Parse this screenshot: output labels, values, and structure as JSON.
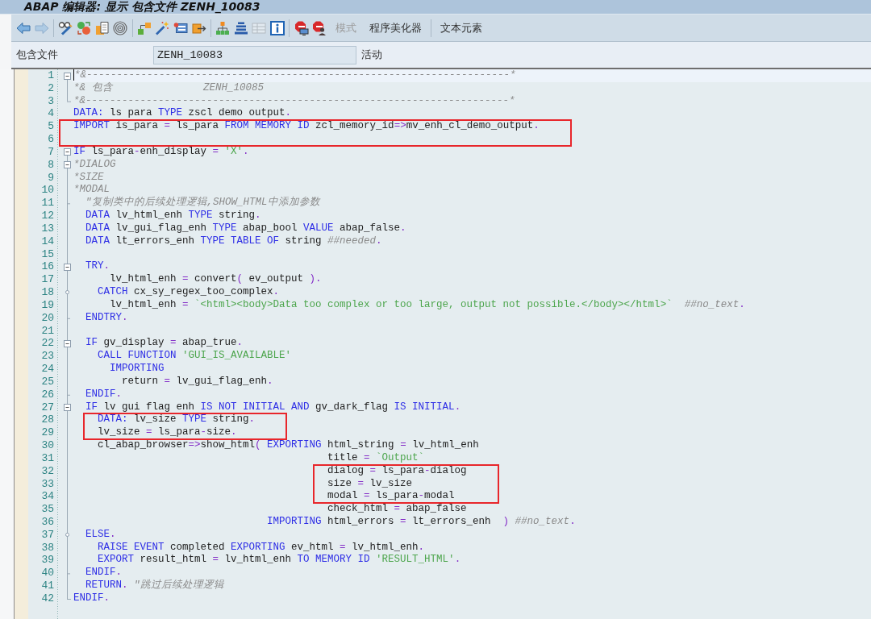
{
  "window": {
    "title": "ABAP 编辑器: 显示 包含文件 ZENH_10083"
  },
  "toolbar": [
    {
      "kind": "icon",
      "disabled": false
    },
    {
      "kind": "icon",
      "disabled": true
    },
    {
      "kind": "separator"
    },
    {
      "kind": "icon",
      "disabled": false
    },
    {
      "kind": "icon",
      "disabled": false
    },
    {
      "kind": "icon",
      "disabled": false
    },
    {
      "kind": "icon",
      "disabled": false
    },
    {
      "kind": "separator"
    },
    {
      "kind": "icon",
      "disabled": false
    },
    {
      "kind": "icon",
      "disabled": false
    },
    {
      "kind": "icon",
      "disabled": false
    },
    {
      "kind": "icon",
      "disabled": false
    },
    {
      "kind": "separator"
    },
    {
      "kind": "icon",
      "disabled": false
    },
    {
      "kind": "icon",
      "disabled": false
    },
    {
      "kind": "icon",
      "disabled": true
    },
    {
      "kind": "icon",
      "disabled": false
    },
    {
      "kind": "separator"
    },
    {
      "kind": "icon",
      "disabled": false
    },
    {
      "kind": "icon",
      "disabled": false
    },
    {
      "kind": "text",
      "label": "模式",
      "disabled": true
    },
    {
      "kind": "text",
      "label": "程序美化器",
      "disabled": false
    },
    {
      "kind": "separator"
    },
    {
      "kind": "text",
      "label": "文本元素",
      "disabled": false
    }
  ],
  "include": {
    "label": "包含文件",
    "value": "ZENH_10083",
    "status": "活动"
  },
  "editor": {
    "lines": [
      {
        "number": "1",
        "current": true,
        "boxed": false,
        "kind": "open",
        "tokens": [
          {
            "kind": "comment",
            "text": "*&----------------------------------------------------------------------*"
          }
        ]
      },
      {
        "number": "2",
        "current": false,
        "boxed": false,
        "kind": "line",
        "tokens": [
          {
            "kind": "comment",
            "text": "*& 包含               ZENH_10085"
          }
        ]
      },
      {
        "number": "3",
        "current": false,
        "boxed": false,
        "kind": "end",
        "tokens": [
          {
            "kind": "comment",
            "text": "*&----------------------------------------------------------------------*"
          }
        ]
      },
      {
        "number": "4",
        "current": false,
        "boxed": false,
        "kind": "plain",
        "tokens": [
          {
            "kind": "keyword",
            "text": "DATA:"
          },
          {
            "kind": "name",
            "text": " ls para "
          },
          {
            "kind": "keyword",
            "text": "TYPE"
          },
          {
            "kind": "name",
            "text": " zscl demo output"
          },
          {
            "kind": "operator",
            "text": "."
          }
        ]
      },
      {
        "number": "5",
        "current": false,
        "boxed": true,
        "kind": "plain",
        "tokens": [
          {
            "kind": "keyword",
            "text": "IMPORT"
          },
          {
            "kind": "name",
            "text": " is_para "
          },
          {
            "kind": "operator",
            "text": "="
          },
          {
            "kind": "name",
            "text": " ls_para "
          },
          {
            "kind": "keyword",
            "text": "FROM MEMORY ID"
          },
          {
            "kind": "name",
            "text": " zcl_memory_id"
          },
          {
            "kind": "operator",
            "text": "=>"
          },
          {
            "kind": "name",
            "text": "mv_enh_cl_demo_output"
          },
          {
            "kind": "operator",
            "text": "."
          }
        ]
      },
      {
        "number": "6",
        "current": false,
        "boxed": true,
        "kind": "plain"
      },
      {
        "number": "7",
        "current": false,
        "boxed": false,
        "kind": "open",
        "tokens": [
          {
            "kind": "keyword",
            "text": "IF"
          },
          {
            "kind": "name",
            "text": " ls_para"
          },
          {
            "kind": "operator",
            "text": "-"
          },
          {
            "kind": "name",
            "text": "enh_display "
          },
          {
            "kind": "operator",
            "text": "= "
          },
          {
            "kind": "string",
            "text": "'X'"
          },
          {
            "kind": "operator",
            "text": "."
          }
        ]
      },
      {
        "number": "8",
        "current": false,
        "boxed": false,
        "kind": "open",
        "tokens": [
          {
            "kind": "comment",
            "text": "*DIALOG"
          }
        ]
      },
      {
        "number": "9",
        "current": false,
        "boxed": false,
        "kind": "line",
        "tokens": [
          {
            "kind": "comment",
            "text": "*SIZE"
          }
        ]
      },
      {
        "number": "10",
        "current": false,
        "boxed": false,
        "kind": "line",
        "tokens": [
          {
            "kind": "comment",
            "text": "*MODAL"
          }
        ]
      },
      {
        "number": "11",
        "current": false,
        "boxed": false,
        "kind": "tick",
        "tokens": [
          {
            "kind": "comment",
            "text": "  \"复制类中的后续处理逻辑,SHOW_HTML中添加参数"
          }
        ]
      },
      {
        "number": "12",
        "current": false,
        "boxed": false,
        "kind": "line",
        "tokens": [
          {
            "kind": "keyword",
            "text": "  DATA"
          },
          {
            "kind": "name",
            "text": " lv_html_enh "
          },
          {
            "kind": "keyword",
            "text": "TYPE"
          },
          {
            "kind": "name",
            "text": " string"
          },
          {
            "kind": "operator",
            "text": "."
          }
        ]
      },
      {
        "number": "13",
        "current": false,
        "boxed": false,
        "kind": "line",
        "tokens": [
          {
            "kind": "keyword",
            "text": "  DATA"
          },
          {
            "kind": "name",
            "text": " lv_gui_flag_enh "
          },
          {
            "kind": "keyword",
            "text": "TYPE"
          },
          {
            "kind": "name",
            "text": " abap_bool "
          },
          {
            "kind": "keyword",
            "text": "VALUE"
          },
          {
            "kind": "name",
            "text": " abap_false"
          },
          {
            "kind": "operator",
            "text": "."
          }
        ]
      },
      {
        "number": "14",
        "current": false,
        "boxed": false,
        "kind": "line",
        "tokens": [
          {
            "kind": "keyword",
            "text": "  DATA"
          },
          {
            "kind": "name",
            "text": " lt_errors_enh "
          },
          {
            "kind": "keyword",
            "text": "TYPE TABLE OF"
          },
          {
            "kind": "name",
            "text": " string "
          },
          {
            "kind": "comment",
            "text": "##needed"
          },
          {
            "kind": "operator",
            "text": "."
          }
        ]
      },
      {
        "number": "15",
        "current": false,
        "boxed": false,
        "kind": "line"
      },
      {
        "number": "16",
        "current": false,
        "boxed": false,
        "kind": "open",
        "tokens": [
          {
            "kind": "keyword",
            "text": "  TRY"
          },
          {
            "kind": "operator",
            "text": "."
          }
        ]
      },
      {
        "number": "17",
        "current": false,
        "boxed": false,
        "kind": "line",
        "tokens": [
          {
            "kind": "name",
            "text": "      lv_html_enh "
          },
          {
            "kind": "operator",
            "text": "= "
          },
          {
            "kind": "name",
            "text": "convert"
          },
          {
            "kind": "operator",
            "text": "( "
          },
          {
            "kind": "name",
            "text": "ev_output "
          },
          {
            "kind": "operator",
            "text": ")."
          }
        ]
      },
      {
        "number": "18",
        "current": false,
        "boxed": false,
        "kind": "branch",
        "tokens": [
          {
            "kind": "keyword",
            "text": "    CATCH"
          },
          {
            "kind": "name",
            "text": " cx_sy_regex_too_complex"
          },
          {
            "kind": "operator",
            "text": "."
          }
        ]
      },
      {
        "number": "19",
        "current": false,
        "boxed": false,
        "kind": "line",
        "tokens": [
          {
            "kind": "name",
            "text": "      lv_html_enh "
          },
          {
            "kind": "operator",
            "text": "= "
          },
          {
            "kind": "string",
            "text": "`<html><body>Data too complex or too large, output not possible.</body></html>`"
          },
          {
            "kind": "comment",
            "text": "  ##no_text"
          },
          {
            "kind": "operator",
            "text": "."
          }
        ]
      },
      {
        "number": "20",
        "current": false,
        "boxed": false,
        "kind": "tick",
        "tokens": [
          {
            "kind": "keyword",
            "text": "  ENDTRY"
          },
          {
            "kind": "operator",
            "text": "."
          }
        ]
      },
      {
        "number": "21",
        "current": false,
        "boxed": false,
        "kind": "line"
      },
      {
        "number": "22",
        "current": false,
        "boxed": false,
        "kind": "open",
        "tokens": [
          {
            "kind": "keyword",
            "text": "  IF"
          },
          {
            "kind": "name",
            "text": " gv_display "
          },
          {
            "kind": "operator",
            "text": "= "
          },
          {
            "kind": "name",
            "text": "abap_true"
          },
          {
            "kind": "operator",
            "text": "."
          }
        ]
      },
      {
        "number": "23",
        "current": false,
        "boxed": false,
        "kind": "line",
        "tokens": [
          {
            "kind": "keyword",
            "text": "    CALL FUNCTION "
          },
          {
            "kind": "string",
            "text": "'GUI_IS_AVAILABLE'"
          }
        ]
      },
      {
        "number": "24",
        "current": false,
        "boxed": false,
        "kind": "line",
        "tokens": [
          {
            "kind": "keyword",
            "text": "      IMPORTING"
          }
        ]
      },
      {
        "number": "25",
        "current": false,
        "boxed": false,
        "kind": "line",
        "tokens": [
          {
            "kind": "name",
            "text": "        return "
          },
          {
            "kind": "operator",
            "text": "= "
          },
          {
            "kind": "name",
            "text": "lv_gui_flag_enh"
          },
          {
            "kind": "operator",
            "text": "."
          }
        ]
      },
      {
        "number": "26",
        "current": false,
        "boxed": false,
        "kind": "tick",
        "tokens": [
          {
            "kind": "keyword",
            "text": "  ENDIF"
          },
          {
            "kind": "operator",
            "text": "."
          }
        ]
      },
      {
        "number": "27",
        "current": false,
        "boxed": false,
        "kind": "open",
        "tokens": [
          {
            "kind": "keyword",
            "text": "  IF"
          },
          {
            "kind": "name",
            "text": " lv gui flag enh "
          },
          {
            "kind": "keyword",
            "text": "IS NOT INITIAL AND"
          },
          {
            "kind": "name",
            "text": " gv_dark_flag "
          },
          {
            "kind": "keyword",
            "text": "IS INITIAL"
          },
          {
            "kind": "operator",
            "text": "."
          }
        ]
      },
      {
        "number": "28",
        "current": false,
        "boxed": true,
        "kind": "line",
        "tokens": [
          {
            "kind": "keyword",
            "text": "    DATA:"
          },
          {
            "kind": "name",
            "text": " lv_size "
          },
          {
            "kind": "keyword",
            "text": "TYPE"
          },
          {
            "kind": "name",
            "text": " string"
          },
          {
            "kind": "operator",
            "text": "."
          }
        ]
      },
      {
        "number": "29",
        "current": false,
        "boxed": true,
        "kind": "line",
        "tokens": [
          {
            "kind": "name",
            "text": "    lv_size "
          },
          {
            "kind": "operator",
            "text": "= "
          },
          {
            "kind": "name",
            "text": "ls_para"
          },
          {
            "kind": "operator",
            "text": "-"
          },
          {
            "kind": "name",
            "text": "size"
          },
          {
            "kind": "operator",
            "text": "."
          }
        ]
      },
      {
        "number": "30",
        "current": false,
        "boxed": false,
        "kind": "line",
        "tokens": [
          {
            "kind": "name",
            "text": "    cl_abap_browser"
          },
          {
            "kind": "operator",
            "text": "=>"
          },
          {
            "kind": "name",
            "text": "show_html"
          },
          {
            "kind": "operator",
            "text": "( "
          },
          {
            "kind": "keyword",
            "text": "EXPORTING"
          },
          {
            "kind": "name",
            "text": " html_string "
          },
          {
            "kind": "operator",
            "text": "= "
          },
          {
            "kind": "name",
            "text": "lv_html_enh"
          }
        ]
      },
      {
        "number": "31",
        "current": false,
        "boxed": false,
        "kind": "line",
        "tokens": [
          {
            "kind": "name",
            "text": "                                          title "
          },
          {
            "kind": "operator",
            "text": "= "
          },
          {
            "kind": "string",
            "text": "`Output`"
          }
        ]
      },
      {
        "number": "32",
        "current": false,
        "boxed": true,
        "kind": "line",
        "tokens": [
          {
            "kind": "name",
            "text": "                                          dialog "
          },
          {
            "kind": "operator",
            "text": "= "
          },
          {
            "kind": "name",
            "text": "ls_para"
          },
          {
            "kind": "operator",
            "text": "-"
          },
          {
            "kind": "name",
            "text": "dialog"
          }
        ]
      },
      {
        "number": "33",
        "current": false,
        "boxed": true,
        "kind": "line",
        "tokens": [
          {
            "kind": "name",
            "text": "                                          size "
          },
          {
            "kind": "operator",
            "text": "= "
          },
          {
            "kind": "name",
            "text": "lv_size"
          }
        ]
      },
      {
        "number": "34",
        "current": false,
        "boxed": true,
        "kind": "line",
        "tokens": [
          {
            "kind": "name",
            "text": "                                          modal "
          },
          {
            "kind": "operator",
            "text": "= "
          },
          {
            "kind": "name",
            "text": "ls_para"
          },
          {
            "kind": "operator",
            "text": "-"
          },
          {
            "kind": "name",
            "text": "modal"
          }
        ]
      },
      {
        "number": "35",
        "current": false,
        "boxed": false,
        "kind": "line",
        "tokens": [
          {
            "kind": "name",
            "text": "                                          check_html "
          },
          {
            "kind": "operator",
            "text": "= "
          },
          {
            "kind": "name",
            "text": "abap_false"
          }
        ]
      },
      {
        "number": "36",
        "current": false,
        "boxed": false,
        "kind": "line",
        "tokens": [
          {
            "kind": "keyword",
            "text": "                                IMPORTING"
          },
          {
            "kind": "name",
            "text": " html_errors "
          },
          {
            "kind": "operator",
            "text": "= "
          },
          {
            "kind": "name",
            "text": "lt_errors_enh  "
          },
          {
            "kind": "operator",
            "text": ")"
          },
          {
            "kind": "comment",
            "text": " ##no_text"
          },
          {
            "kind": "operator",
            "text": "."
          }
        ]
      },
      {
        "number": "37",
        "current": false,
        "boxed": false,
        "kind": "branch",
        "tokens": [
          {
            "kind": "keyword",
            "text": "  ELSE"
          },
          {
            "kind": "operator",
            "text": "."
          }
        ]
      },
      {
        "number": "38",
        "current": false,
        "boxed": false,
        "kind": "line",
        "tokens": [
          {
            "kind": "keyword",
            "text": "    RAISE EVENT"
          },
          {
            "kind": "name",
            "text": " completed "
          },
          {
            "kind": "keyword",
            "text": "EXPORTING"
          },
          {
            "kind": "name",
            "text": " ev_html "
          },
          {
            "kind": "operator",
            "text": "= "
          },
          {
            "kind": "name",
            "text": "lv_html_enh"
          },
          {
            "kind": "operator",
            "text": "."
          }
        ]
      },
      {
        "number": "39",
        "current": false,
        "boxed": false,
        "kind": "line",
        "tokens": [
          {
            "kind": "keyword",
            "text": "    EXPORT"
          },
          {
            "kind": "name",
            "text": " result_html "
          },
          {
            "kind": "operator",
            "text": "= "
          },
          {
            "kind": "name",
            "text": "lv_html_enh "
          },
          {
            "kind": "keyword",
            "text": "TO MEMORY ID "
          },
          {
            "kind": "string",
            "text": "'RESULT_HTML'"
          },
          {
            "kind": "operator",
            "text": "."
          }
        ]
      },
      {
        "number": "40",
        "current": false,
        "boxed": false,
        "kind": "tick",
        "tokens": [
          {
            "kind": "keyword",
            "text": "  ENDIF"
          },
          {
            "kind": "operator",
            "text": "."
          }
        ]
      },
      {
        "number": "41",
        "current": false,
        "boxed": false,
        "kind": "line",
        "tokens": [
          {
            "kind": "keyword",
            "text": "  RETURN"
          },
          {
            "kind": "operator",
            "text": "."
          },
          {
            "kind": "comment",
            "text": " \"跳过后续处理逻辑"
          }
        ]
      },
      {
        "number": "42",
        "current": false,
        "boxed": false,
        "kind": "end",
        "tokens": [
          {
            "kind": "keyword",
            "text": "ENDIF"
          },
          {
            "kind": "operator",
            "text": "."
          }
        ]
      }
    ]
  }
}
